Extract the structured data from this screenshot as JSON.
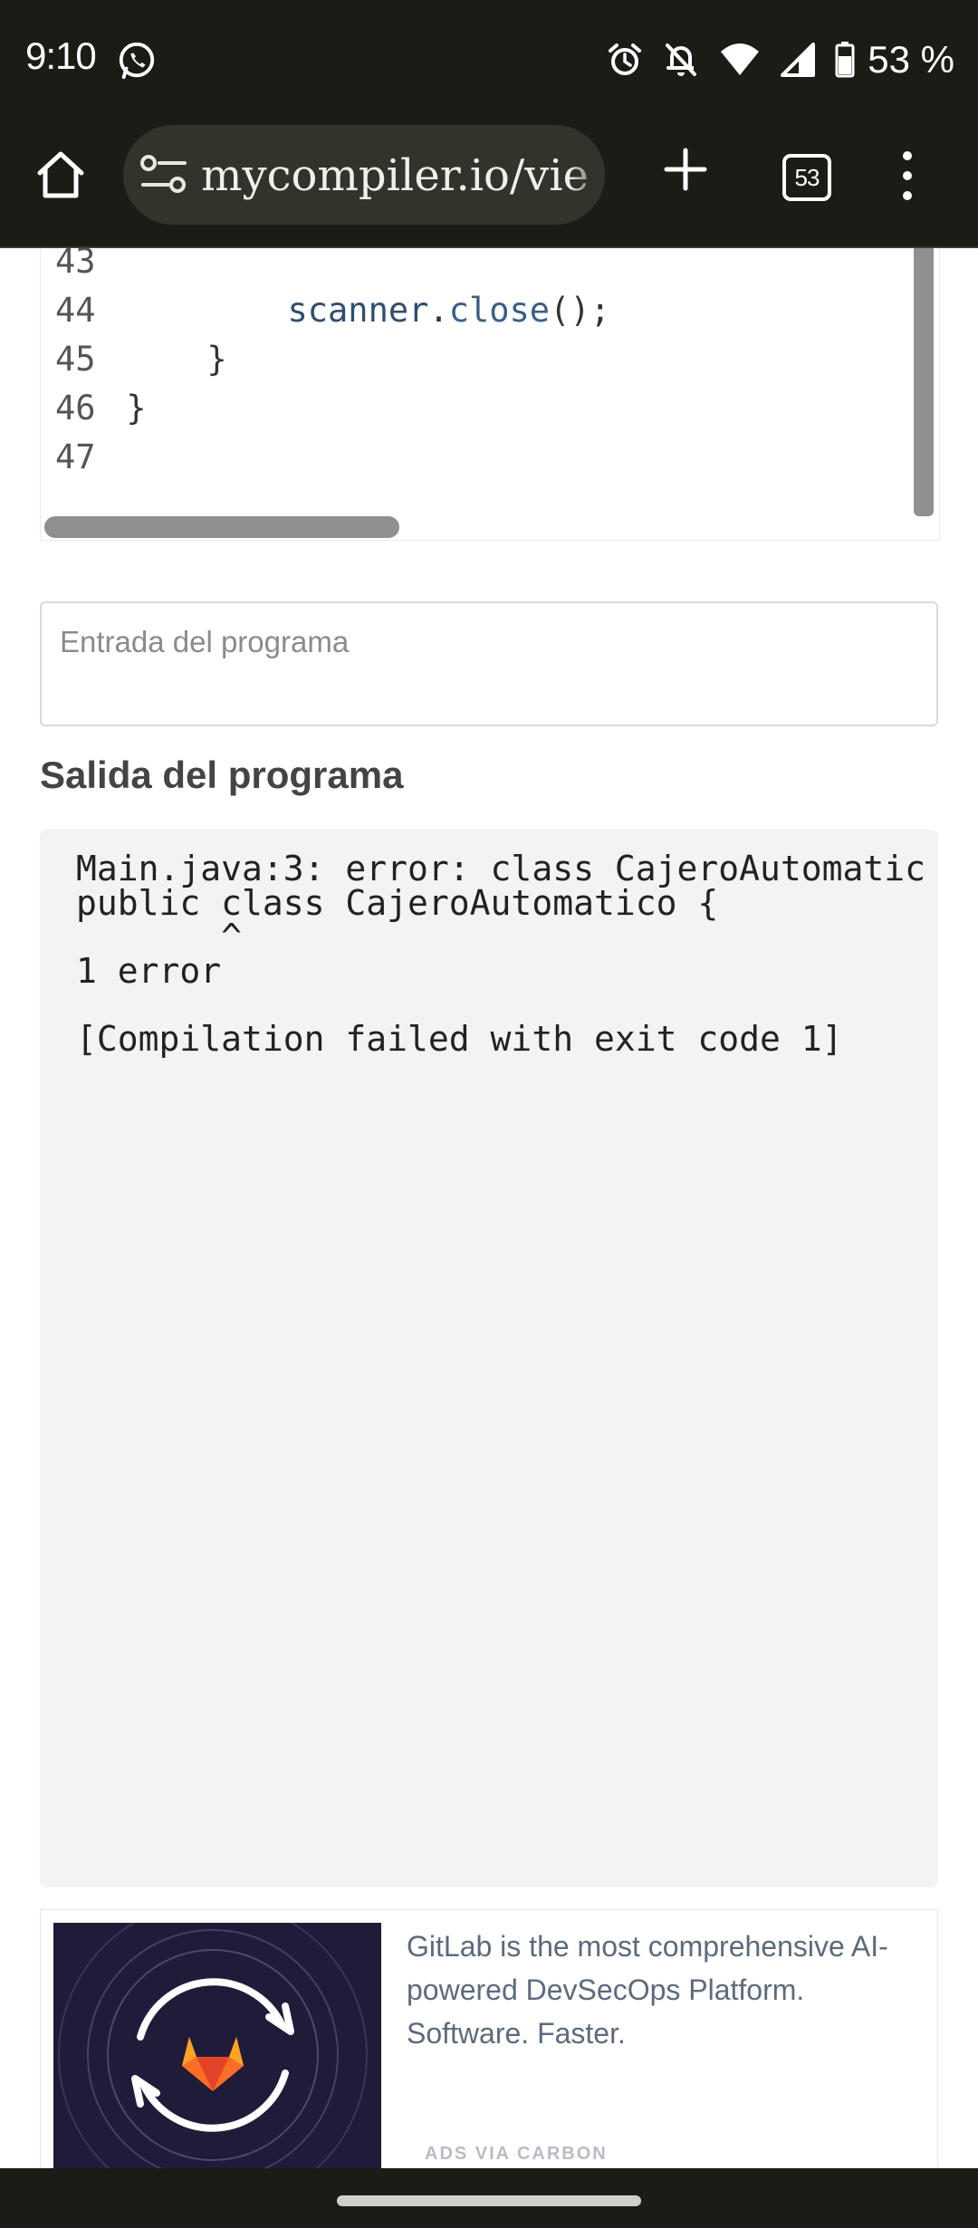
{
  "status_bar": {
    "time": "9:10",
    "battery": "53 %",
    "icons": [
      "whatsapp-icon",
      "alarm-icon",
      "notifications-off-icon",
      "wifi-icon",
      "cellular-signal-icon",
      "battery-icon"
    ]
  },
  "browser": {
    "url": "mycompiler.io/vie",
    "tab_count": "53",
    "icons": [
      "home-icon",
      "site-settings-icon",
      "new-tab-icon",
      "tab-switcher-icon",
      "more-menu-icon"
    ]
  },
  "editor": {
    "lines": [
      {
        "num": "43",
        "indent": "",
        "parts": []
      },
      {
        "num": "44",
        "indent": "        ",
        "parts": [
          {
            "text": "scanner",
            "kind": "id"
          },
          {
            "text": ".",
            "kind": "p"
          },
          {
            "text": "close",
            "kind": "fn"
          },
          {
            "text": "();",
            "kind": "p"
          }
        ]
      },
      {
        "num": "45",
        "indent": "    ",
        "parts": [
          {
            "text": "}",
            "kind": "p"
          }
        ]
      },
      {
        "num": "46",
        "indent": "",
        "parts": [
          {
            "text": "}",
            "kind": "p"
          }
        ]
      },
      {
        "num": "47",
        "indent": "",
        "parts": []
      }
    ]
  },
  "stdin": {
    "placeholder": "Entrada del programa"
  },
  "output": {
    "title": "Salida del programa",
    "lines": [
      "Main.java:3: error: class CajeroAutomatic",
      "public class CajeroAutomatico {",
      "       ^",
      "1 error",
      "",
      "[Compilation failed with exit code 1]"
    ]
  },
  "ad": {
    "text": "GitLab is the most comprehensive AI-powered DevSecOps Platform. Software. Faster.",
    "via": "ADS VIA CARBON"
  },
  "colors": {
    "system_bar": "#1c1c17",
    "url_pill": "#33332b",
    "output_bg": "#f3f3f3",
    "ad_bg": "#211b3a",
    "gitlab_orange": "#fc6d26"
  }
}
